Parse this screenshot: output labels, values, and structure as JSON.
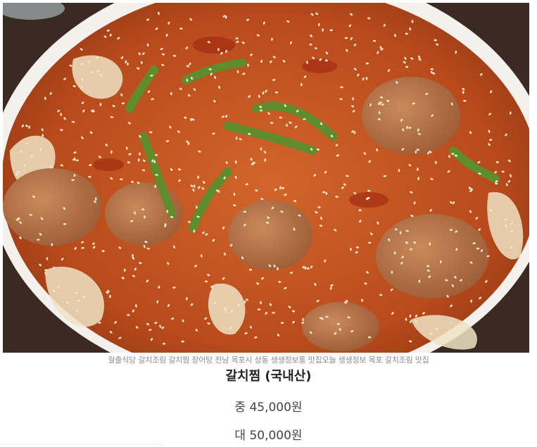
{
  "photo": {
    "alt_subject": "braised-hairtail-dish-photo"
  },
  "caption": "월출식당 갈치조림 갈치찜 장어탕 전남 목포시 상동 생생정보통 맛집오늘 생생정보 목포 갈치조림 맛집",
  "dish": {
    "name": "갈치찜 (국내산)"
  },
  "prices": {
    "medium": "중 45,000원",
    "large": "대 50,000원"
  },
  "colors": {
    "sauce": "#c1531f",
    "plate": "#f4f1ec",
    "table": "#3b2a21",
    "scallion": "#5f8c2c",
    "sesame": "#f3e6c8"
  }
}
